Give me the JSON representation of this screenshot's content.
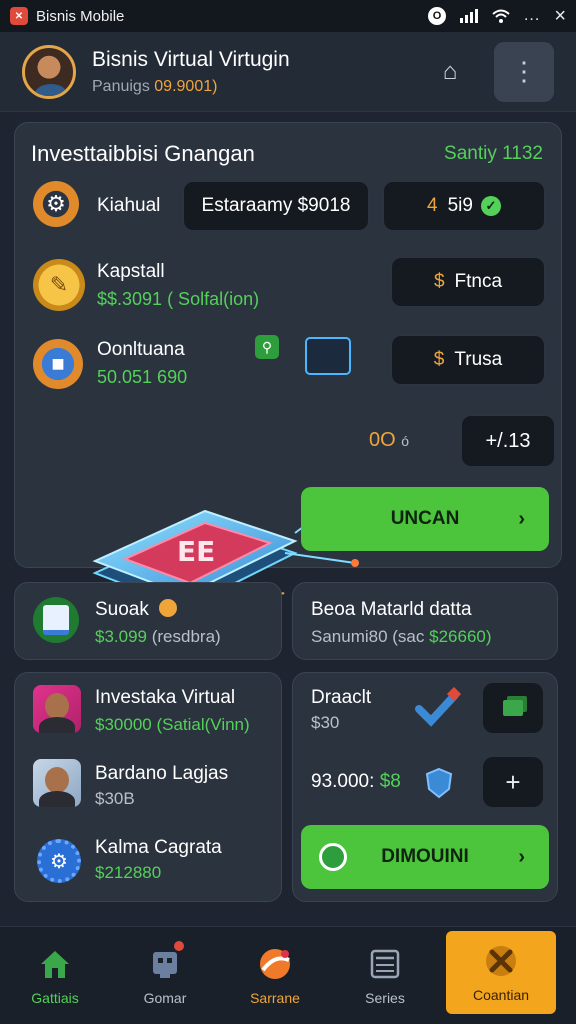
{
  "status_bar": {
    "app_name": "Bisnis Mobile",
    "app_icon": "app-logo-icon",
    "right_icons": [
      "notification-circle-icon",
      "signal-icon",
      "wifi-icon",
      "more-dots-icon",
      "close-icon"
    ],
    "circle_glyph": "O",
    "dots": "...",
    "close": "×"
  },
  "header": {
    "title": "Bisnis Virtual Virtugin",
    "subtitle_prefix": "Panuigs",
    "subtitle_value": "09.9001)",
    "icons": [
      "bell-icon",
      "menu-icon"
    ],
    "bell": "⌂",
    "menu": "⋮"
  },
  "panel": {
    "title": "Investtaibbisi Gnangan",
    "score": "Santiy 1132",
    "rows": [
      {
        "label": "Kiahual",
        "icon": "gear-icon",
        "glyph": "⚙"
      },
      {
        "label": "Kapstall",
        "value": "$$.3091 ( Solfal(ion)",
        "icon": "coin-icon",
        "glyph": "✎"
      },
      {
        "label": "Oonltuana",
        "value": "50.051 690",
        "icon": "cube-icon",
        "glyph": "■"
      }
    ],
    "pill_estimate": "Estaraamy $9018",
    "pill_right1_accent": "4",
    "pill_right1_text": "5i9",
    "pill_right2_accent": "$",
    "pill_right2_text": "Ftnca",
    "pill_right3_accent": "$",
    "pill_right3_text": "Trusa",
    "chip_text": "0O",
    "chip_small": "ó",
    "value_box": "+/.13",
    "green_button": "UNCAN",
    "chevron": "›",
    "check": "✓"
  },
  "cards": {
    "card1": {
      "label": "Suoak",
      "value_green": "$3.099",
      "value_rest": "(resdbra)",
      "icon": "document-icon"
    },
    "card2": {
      "label": "Beoa Matarld datta",
      "value_prefix": "Sanumi80 (sac",
      "value_green": "$26660)"
    },
    "card3": {
      "rows": [
        {
          "label": "Investaka Virtual",
          "value": "$30000 (Satial(Vinn)",
          "icon": "avatar-1"
        },
        {
          "label": "Bardano Lagjas",
          "value": "$30B",
          "icon": "avatar-2"
        },
        {
          "label": "Kalma Cagrata",
          "value": "$212880",
          "icon": "settings-gear-icon",
          "glyph": "⚙"
        }
      ]
    },
    "card4": {
      "label": "Draaclt",
      "value": "$30",
      "line2_prefix": "93.000:",
      "line2_green": "$8",
      "plus": "+",
      "button": "DIMOUINI",
      "icons": [
        "heart-tag-icon",
        "copy-icon",
        "shield-icon",
        "plus-icon",
        "whatsapp-icon"
      ]
    }
  },
  "nav": [
    {
      "label": "Gattiais",
      "icon": "home-icon",
      "state": "green"
    },
    {
      "label": "Gomar",
      "icon": "store-icon",
      "state": "default"
    },
    {
      "label": "Sarrane",
      "icon": "ball-icon",
      "state": "orange"
    },
    {
      "label": "Series",
      "icon": "calculator-icon",
      "state": "default"
    },
    {
      "label": "Coantian",
      "icon": "cross-tools-icon",
      "state": "highlight"
    }
  ],
  "colors": {
    "background": "#1e2530",
    "card": "#2b333f",
    "accent_green": "#4cc43c",
    "accent_orange": "#f0a53a"
  }
}
